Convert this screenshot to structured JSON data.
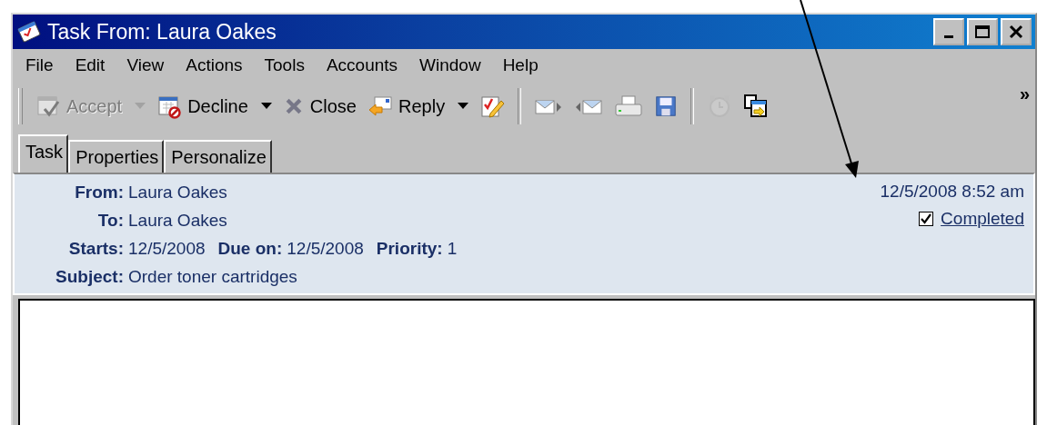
{
  "window": {
    "title": "Task From: Laura Oakes"
  },
  "menu": [
    {
      "label": "File"
    },
    {
      "label": "Edit"
    },
    {
      "label": "View"
    },
    {
      "label": "Actions"
    },
    {
      "label": "Tools"
    },
    {
      "label": "Accounts"
    },
    {
      "label": "Window"
    },
    {
      "label": "Help"
    }
  ],
  "toolbar": [
    {
      "kind": "button",
      "label": "Accept",
      "disabled": true,
      "dropdown": true
    },
    {
      "kind": "button",
      "label": "Decline",
      "disabled": false,
      "dropdown": true
    },
    {
      "kind": "button",
      "label": "Close",
      "disabled": false,
      "dropdown": false
    },
    {
      "kind": "button",
      "label": "Reply",
      "disabled": false,
      "dropdown": true
    },
    {
      "kind": "icon",
      "disabled": false
    },
    {
      "kind": "separator"
    },
    {
      "kind": "icon",
      "disabled": false
    },
    {
      "kind": "icon",
      "disabled": false
    },
    {
      "kind": "icon",
      "disabled": false
    },
    {
      "kind": "icon",
      "disabled": false
    },
    {
      "kind": "separator"
    },
    {
      "kind": "icon",
      "disabled": true
    },
    {
      "kind": "icon",
      "disabled": false
    }
  ],
  "toolbar_overflow": "»",
  "tabs": [
    {
      "label": "Task",
      "selected": true
    },
    {
      "label": "Properties",
      "selected": false
    },
    {
      "label": "Personalize",
      "selected": false
    }
  ],
  "header": {
    "rows": [
      [
        {
          "label": "From:",
          "value": "Laura Oakes"
        }
      ],
      [
        {
          "label": "To:",
          "value": "Laura Oakes"
        }
      ],
      [
        {
          "label": "Starts:",
          "value": "12/5/2008"
        },
        {
          "label": "Due on:",
          "value": "12/5/2008"
        },
        {
          "label": "Priority:",
          "value": "1"
        }
      ],
      [
        {
          "label": "Subject:",
          "value": "Order toner cartridges"
        }
      ]
    ],
    "timestamp": "12/5/2008 8:52 am",
    "completed": {
      "label": "Completed",
      "checked": true
    }
  }
}
